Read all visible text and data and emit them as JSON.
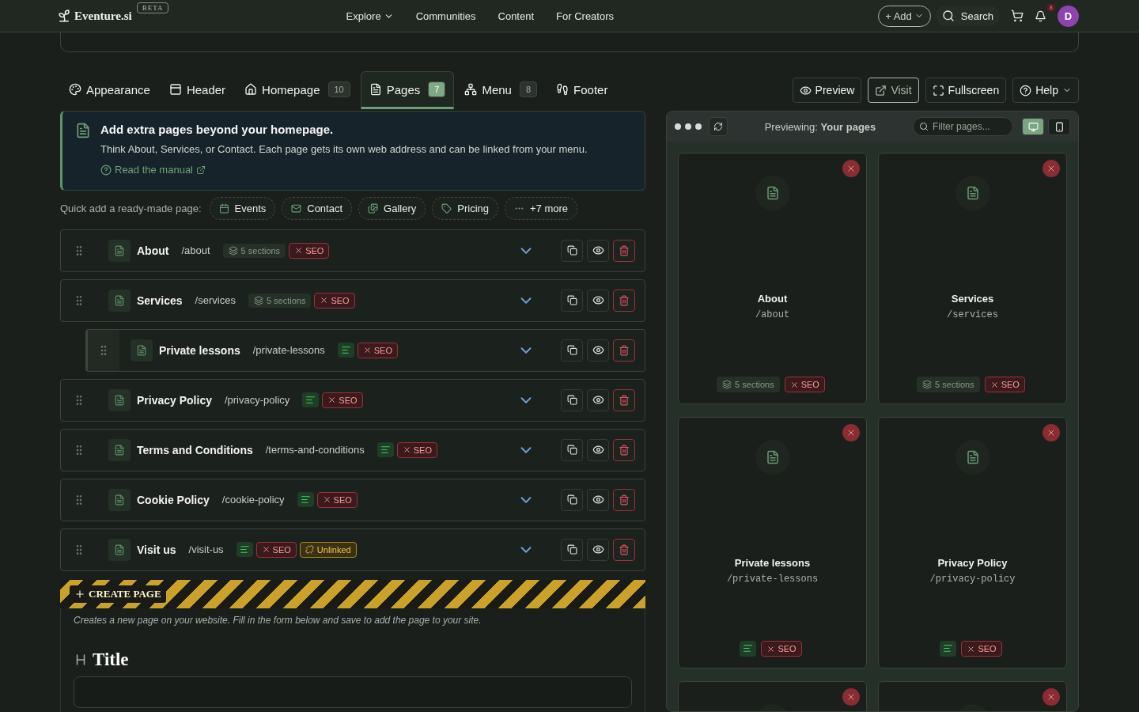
{
  "nav": {
    "logo": "Eventure.si",
    "beta": "BETA",
    "links": [
      {
        "label": "Explore",
        "dropdown": true
      },
      {
        "label": "Communities",
        "dropdown": false
      },
      {
        "label": "Content",
        "dropdown": false
      },
      {
        "label": "For Creators",
        "dropdown": false
      }
    ],
    "add": "+ Add",
    "search": "Search",
    "notifications": "8",
    "avatar": "D"
  },
  "tabs": [
    {
      "label": "Appearance",
      "selected": false
    },
    {
      "label": "Header",
      "selected": false
    },
    {
      "label": "Homepage",
      "count": "10",
      "selected": false
    },
    {
      "label": "Pages",
      "count": "7",
      "selected": true
    },
    {
      "label": "Menu",
      "count": "8",
      "selected": false
    },
    {
      "label": "Footer",
      "selected": false
    }
  ],
  "toolbar": [
    {
      "label": "Preview",
      "dropdown": false,
      "selected": false
    },
    {
      "label": "Visit",
      "dropdown": false,
      "selected": true
    },
    {
      "label": "Fullscreen",
      "dropdown": false,
      "selected": false
    },
    {
      "label": "Help",
      "dropdown": true,
      "selected": false
    }
  ],
  "info": {
    "title": "Add extra pages beyond your homepage.",
    "text": "Think About, Services, or Contact. Each page gets its own web address and can be linked from your menu.",
    "link": "Read the manual"
  },
  "quick_add": {
    "label": "Quick add a ready-made page:",
    "items": [
      {
        "label": "Events"
      },
      {
        "label": "Contact"
      },
      {
        "label": "Gallery"
      },
      {
        "label": "Pricing"
      },
      {
        "label": "+7 more"
      }
    ]
  },
  "pages": [
    {
      "title": "About",
      "path": "/about",
      "kind": "sections",
      "sections": "5 sections",
      "seo": "SEO"
    },
    {
      "title": "Services",
      "path": "/services",
      "kind": "sections",
      "sections": "5 sections",
      "seo": "SEO",
      "children": [
        {
          "title": "Private lessons",
          "path": "/private-lessons",
          "kind": "content",
          "seo": "SEO"
        }
      ]
    },
    {
      "title": "Privacy Policy",
      "path": "/privacy-policy",
      "kind": "content",
      "seo": "SEO"
    },
    {
      "title": "Terms and Conditions",
      "path": "/terms-and-conditions",
      "kind": "content",
      "seo": "SEO"
    },
    {
      "title": "Cookie Policy",
      "path": "/cookie-policy",
      "kind": "content",
      "seo": "SEO"
    },
    {
      "title": "Visit us",
      "path": "/visit-us",
      "kind": "content",
      "seo": "SEO",
      "unlinked": "Unlinked"
    }
  ],
  "create": {
    "label": "CREATE PAGE",
    "hint": "Creates a new page on your website. Fill in the form below and save to add the page to your site.",
    "field_label": "Title"
  },
  "preview": {
    "prefix": "Previewing:",
    "subject": "Your pages",
    "filter_placeholder": "Filter pages...",
    "devices": [
      {
        "kind": "desktop",
        "selected": true
      },
      {
        "kind": "mobile",
        "selected": false
      }
    ],
    "cards": [
      {
        "title": "About",
        "path": "/about",
        "kind": "sections",
        "sections": "5 sections",
        "seo": "SEO"
      },
      {
        "title": "Services",
        "path": "/services",
        "kind": "sections",
        "sections": "5 sections",
        "seo": "SEO"
      },
      {
        "title": "Private lessons",
        "path": "/private-lessons",
        "kind": "content",
        "seo": "SEO"
      },
      {
        "title": "Privacy Policy",
        "path": "/privacy-policy",
        "kind": "content",
        "seo": "SEO"
      },
      {
        "kind": "hidden"
      },
      {
        "kind": "hidden"
      }
    ]
  }
}
